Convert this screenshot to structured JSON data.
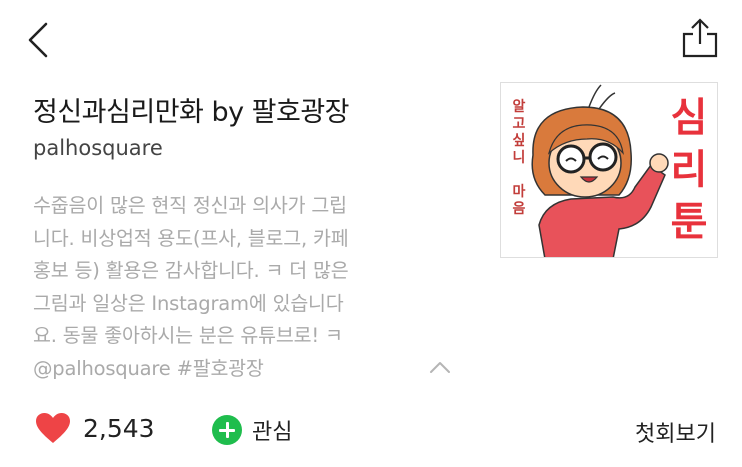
{
  "header": {
    "back_icon": "chevron-left-icon",
    "share_icon": "share-icon"
  },
  "series": {
    "title": "정신과심리만화 by 팔호광장",
    "author": "palhosquare",
    "description": "수줍음이 많은 현직 정신과 의사가 그립\n니다. 비상업적 용도(프사, 블로그, 카페\n홍보 등) 활용은 감사합니다. ㅋ 더 많은\n그림과 일상은 Instagram에 있습니다\n요. 동물 좋아하시는 분은 유튜브로! ㅋ\n@palhosquare #팔호광장",
    "thumbnail": {
      "side_text": [
        "알",
        "고",
        "싶",
        "니",
        "",
        "마",
        "음"
      ],
      "big_text": [
        "심",
        "리",
        "툰"
      ],
      "accent_color": "#e8323c",
      "side_color": "#c23d3a"
    }
  },
  "actions": {
    "like_count": "2,543",
    "like_color": "#ee4446",
    "follow_label": "관심",
    "follow_color": "#1fbd4d",
    "first_episode_label": "첫회보기"
  }
}
